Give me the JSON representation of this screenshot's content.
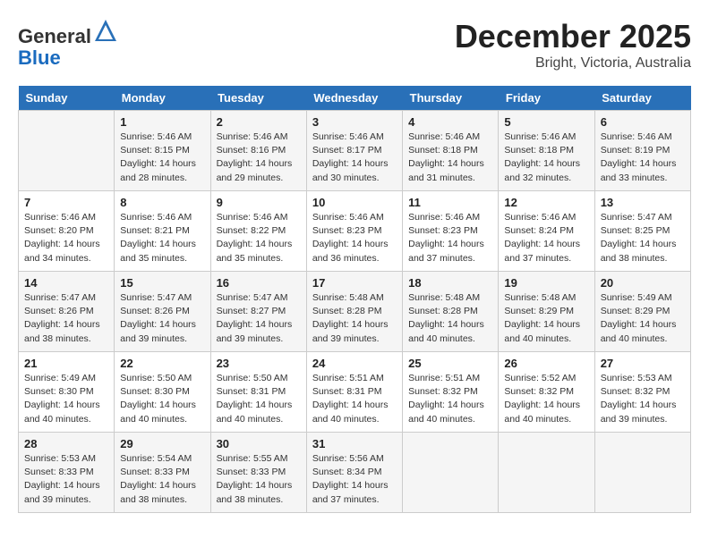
{
  "header": {
    "logo_general": "General",
    "logo_blue": "Blue",
    "month": "December 2025",
    "location": "Bright, Victoria, Australia"
  },
  "days_of_week": [
    "Sunday",
    "Monday",
    "Tuesday",
    "Wednesday",
    "Thursday",
    "Friday",
    "Saturday"
  ],
  "weeks": [
    [
      {
        "day": "",
        "content": ""
      },
      {
        "day": "1",
        "content": "Sunrise: 5:46 AM\nSunset: 8:15 PM\nDaylight: 14 hours\nand 28 minutes."
      },
      {
        "day": "2",
        "content": "Sunrise: 5:46 AM\nSunset: 8:16 PM\nDaylight: 14 hours\nand 29 minutes."
      },
      {
        "day": "3",
        "content": "Sunrise: 5:46 AM\nSunset: 8:17 PM\nDaylight: 14 hours\nand 30 minutes."
      },
      {
        "day": "4",
        "content": "Sunrise: 5:46 AM\nSunset: 8:18 PM\nDaylight: 14 hours\nand 31 minutes."
      },
      {
        "day": "5",
        "content": "Sunrise: 5:46 AM\nSunset: 8:18 PM\nDaylight: 14 hours\nand 32 minutes."
      },
      {
        "day": "6",
        "content": "Sunrise: 5:46 AM\nSunset: 8:19 PM\nDaylight: 14 hours\nand 33 minutes."
      }
    ],
    [
      {
        "day": "7",
        "content": "Sunrise: 5:46 AM\nSunset: 8:20 PM\nDaylight: 14 hours\nand 34 minutes."
      },
      {
        "day": "8",
        "content": "Sunrise: 5:46 AM\nSunset: 8:21 PM\nDaylight: 14 hours\nand 35 minutes."
      },
      {
        "day": "9",
        "content": "Sunrise: 5:46 AM\nSunset: 8:22 PM\nDaylight: 14 hours\nand 35 minutes."
      },
      {
        "day": "10",
        "content": "Sunrise: 5:46 AM\nSunset: 8:23 PM\nDaylight: 14 hours\nand 36 minutes."
      },
      {
        "day": "11",
        "content": "Sunrise: 5:46 AM\nSunset: 8:23 PM\nDaylight: 14 hours\nand 37 minutes."
      },
      {
        "day": "12",
        "content": "Sunrise: 5:46 AM\nSunset: 8:24 PM\nDaylight: 14 hours\nand 37 minutes."
      },
      {
        "day": "13",
        "content": "Sunrise: 5:47 AM\nSunset: 8:25 PM\nDaylight: 14 hours\nand 38 minutes."
      }
    ],
    [
      {
        "day": "14",
        "content": "Sunrise: 5:47 AM\nSunset: 8:26 PM\nDaylight: 14 hours\nand 38 minutes."
      },
      {
        "day": "15",
        "content": "Sunrise: 5:47 AM\nSunset: 8:26 PM\nDaylight: 14 hours\nand 39 minutes."
      },
      {
        "day": "16",
        "content": "Sunrise: 5:47 AM\nSunset: 8:27 PM\nDaylight: 14 hours\nand 39 minutes."
      },
      {
        "day": "17",
        "content": "Sunrise: 5:48 AM\nSunset: 8:28 PM\nDaylight: 14 hours\nand 39 minutes."
      },
      {
        "day": "18",
        "content": "Sunrise: 5:48 AM\nSunset: 8:28 PM\nDaylight: 14 hours\nand 40 minutes."
      },
      {
        "day": "19",
        "content": "Sunrise: 5:48 AM\nSunset: 8:29 PM\nDaylight: 14 hours\nand 40 minutes."
      },
      {
        "day": "20",
        "content": "Sunrise: 5:49 AM\nSunset: 8:29 PM\nDaylight: 14 hours\nand 40 minutes."
      }
    ],
    [
      {
        "day": "21",
        "content": "Sunrise: 5:49 AM\nSunset: 8:30 PM\nDaylight: 14 hours\nand 40 minutes."
      },
      {
        "day": "22",
        "content": "Sunrise: 5:50 AM\nSunset: 8:30 PM\nDaylight: 14 hours\nand 40 minutes."
      },
      {
        "day": "23",
        "content": "Sunrise: 5:50 AM\nSunset: 8:31 PM\nDaylight: 14 hours\nand 40 minutes."
      },
      {
        "day": "24",
        "content": "Sunrise: 5:51 AM\nSunset: 8:31 PM\nDaylight: 14 hours\nand 40 minutes."
      },
      {
        "day": "25",
        "content": "Sunrise: 5:51 AM\nSunset: 8:32 PM\nDaylight: 14 hours\nand 40 minutes."
      },
      {
        "day": "26",
        "content": "Sunrise: 5:52 AM\nSunset: 8:32 PM\nDaylight: 14 hours\nand 40 minutes."
      },
      {
        "day": "27",
        "content": "Sunrise: 5:53 AM\nSunset: 8:32 PM\nDaylight: 14 hours\nand 39 minutes."
      }
    ],
    [
      {
        "day": "28",
        "content": "Sunrise: 5:53 AM\nSunset: 8:33 PM\nDaylight: 14 hours\nand 39 minutes."
      },
      {
        "day": "29",
        "content": "Sunrise: 5:54 AM\nSunset: 8:33 PM\nDaylight: 14 hours\nand 38 minutes."
      },
      {
        "day": "30",
        "content": "Sunrise: 5:55 AM\nSunset: 8:33 PM\nDaylight: 14 hours\nand 38 minutes."
      },
      {
        "day": "31",
        "content": "Sunrise: 5:56 AM\nSunset: 8:34 PM\nDaylight: 14 hours\nand 37 minutes."
      },
      {
        "day": "",
        "content": ""
      },
      {
        "day": "",
        "content": ""
      },
      {
        "day": "",
        "content": ""
      }
    ]
  ]
}
